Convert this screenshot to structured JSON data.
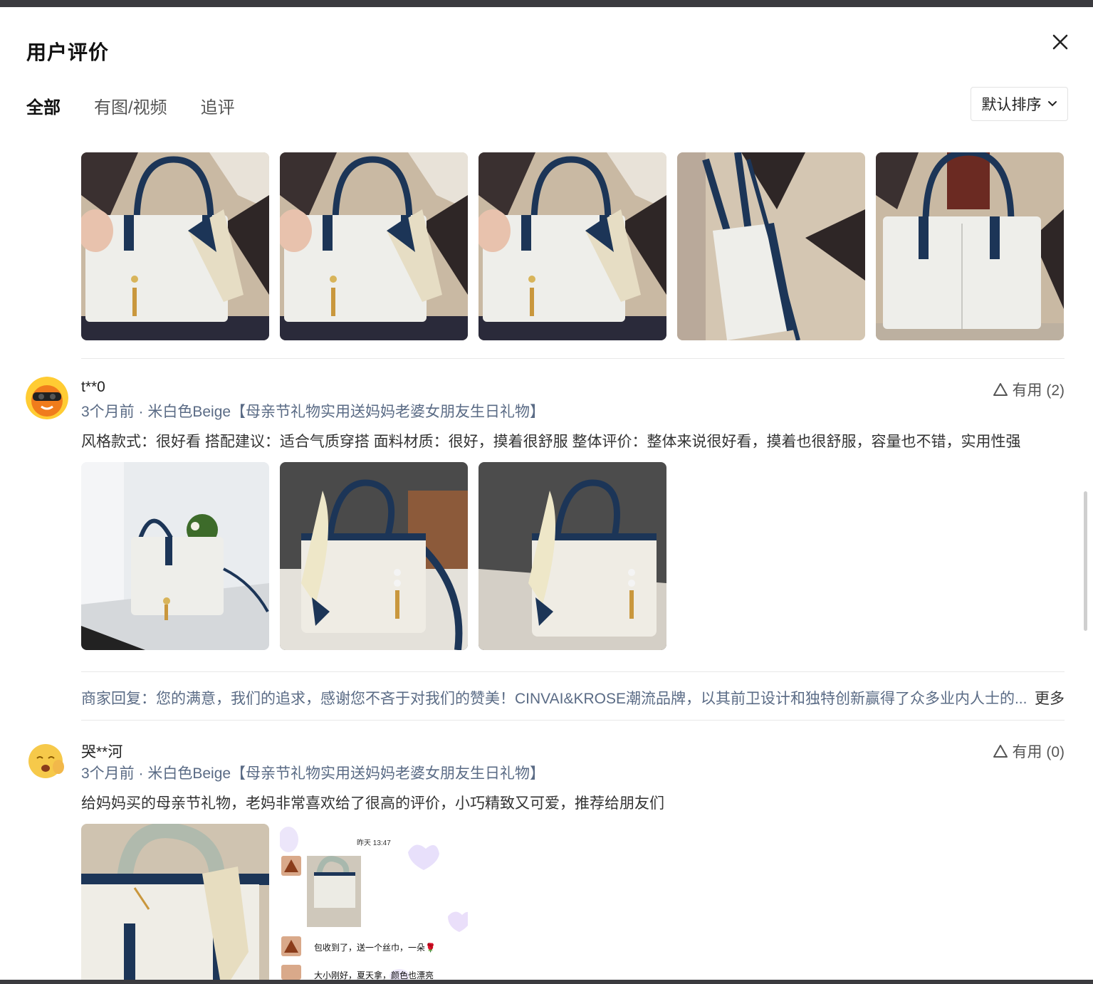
{
  "dialog": {
    "title": "用户评价"
  },
  "tabs": [
    {
      "label": "全部",
      "active": true
    },
    {
      "label": "有图/视频",
      "active": false
    },
    {
      "label": "追评",
      "active": false
    }
  ],
  "sort": {
    "label": "默认排序"
  },
  "reviews": [
    {
      "username": "t**0",
      "meta": "3个月前 · 米白色Beige【母亲节礼物实用送妈妈老婆女朋友生日礼物】",
      "useful": "有用 (2)",
      "comment": "风格款式：很好看 搭配建议：适合气质穿搭 面料材质：很好，摸着很舒服 整体评价：整体来说很好看，摸着也很舒服，容量也不错，实用性强",
      "reply": "商家回复：您的满意，我们的追求，感谢您不吝于对我们的赞美！CINVAI&KROSE潮流品牌，以其前卫设计和独特创新赢得了众多业内人士的...",
      "reply_more": "更多"
    },
    {
      "username": "哭**河",
      "meta": "3个月前 · 米白色Beige【母亲节礼物实用送妈妈老婆女朋友生日礼物】",
      "useful": "有用 (0)",
      "comment": "给妈妈买的母亲节礼物，老妈非常喜欢给了很高的评价，小巧精致又可爱，推荐给朋友们"
    }
  ],
  "chat_screenshot": {
    "time": "昨天 13:47",
    "msg1": "包收到了，送一个丝巾，一朵🌹",
    "msg2": "大小刚好，夏天拿，颜色也漂亮"
  },
  "colors": {
    "accent_blue": "#5a6b85",
    "bag_navy": "#1c3557",
    "bag_white": "#eeeeea"
  }
}
